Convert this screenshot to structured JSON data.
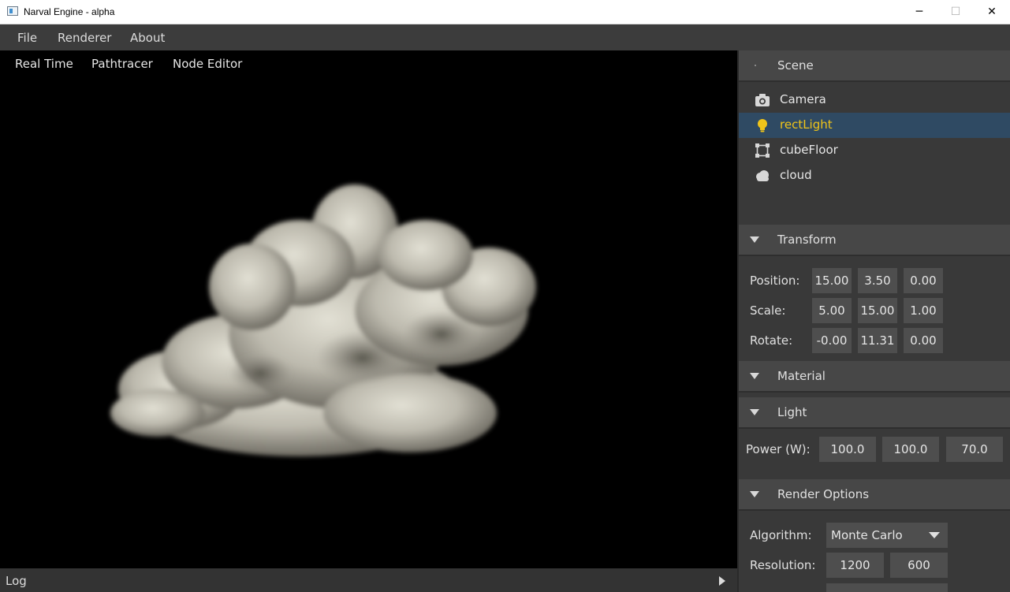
{
  "window": {
    "title": "Narval Engine - alpha",
    "minimize": "─",
    "maximize": "☐",
    "close": "✕"
  },
  "menubar": {
    "items": [
      "File",
      "Renderer",
      "About"
    ]
  },
  "viewport": {
    "tabs": [
      "Real Time",
      "Pathtracer",
      "Node Editor"
    ]
  },
  "log": {
    "label": "Log"
  },
  "panel": {
    "scene": {
      "title": "Scene",
      "items": [
        {
          "label": "Camera",
          "icon": "camera-icon",
          "selected": false
        },
        {
          "label": "rectLight",
          "icon": "lightbulb-icon",
          "selected": true
        },
        {
          "label": "cubeFloor",
          "icon": "cube-icon",
          "selected": false
        },
        {
          "label": "cloud",
          "icon": "cloud-icon",
          "selected": false
        }
      ]
    },
    "transform": {
      "title": "Transform",
      "position_label": "Position:",
      "position": [
        "15.00",
        "3.50",
        "0.00"
      ],
      "scale_label": "Scale:",
      "scale": [
        "5.00",
        "15.00",
        "1.00"
      ],
      "rotate_label": "Rotate:",
      "rotate": [
        "-0.00",
        "11.31",
        "0.00"
      ]
    },
    "material": {
      "title": "Material"
    },
    "light": {
      "title": "Light",
      "power_label": "Power (W):",
      "power": [
        "100.0",
        "100.0",
        "70.0"
      ]
    },
    "render_options": {
      "title": "Render Options",
      "algorithm_label": "Algorithm:",
      "algorithm_value": "Monte Carlo",
      "resolution_label": "Resolution:",
      "resolution": [
        "1200",
        "600"
      ]
    }
  },
  "colors": {
    "selected_row": "#2f4a63",
    "selected_text": "#f0c419",
    "panel_bg": "#393939"
  }
}
